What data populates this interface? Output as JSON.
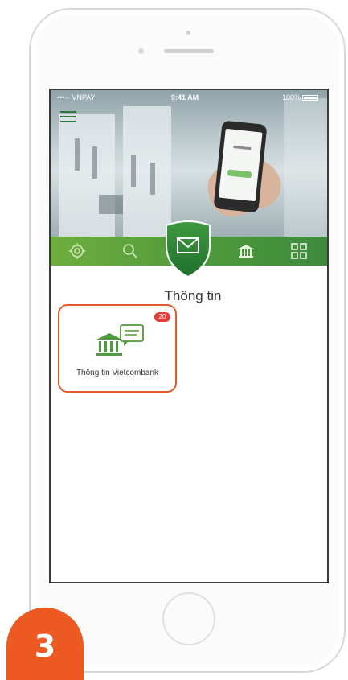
{
  "status_bar": {
    "carrier": "•••◦◦ VNPAY",
    "time": "9:41 AM",
    "battery": "100%"
  },
  "menu": {
    "items": [
      {
        "icon": "settings-icon"
      },
      {
        "icon": "search-icon"
      },
      {
        "icon": "mail-icon",
        "active": true
      },
      {
        "icon": "bank-icon"
      },
      {
        "icon": "grid-icon"
      }
    ]
  },
  "section": {
    "title": "Thông tin"
  },
  "tiles": [
    {
      "label": "Thông tin Vietcombank",
      "badge": "20",
      "icon": "bank-message-icon"
    }
  ],
  "step": {
    "number": "3"
  },
  "colors": {
    "brand_green": "#4f9a3c",
    "accent_orange": "#ec5a22",
    "badge_red": "#e23b3b"
  }
}
